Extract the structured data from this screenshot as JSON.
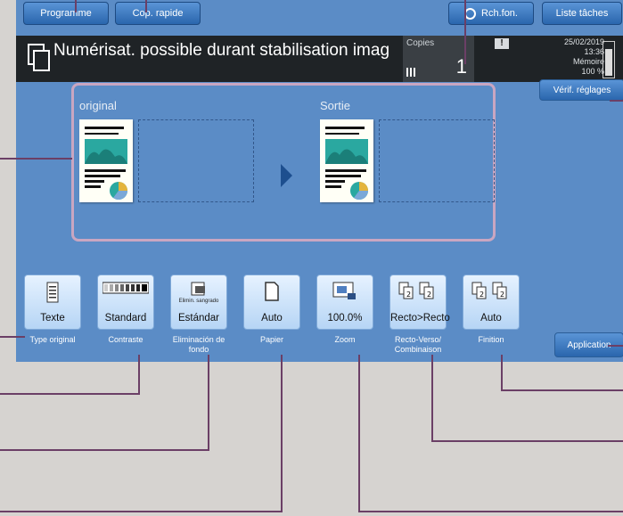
{
  "top_buttons": {
    "program": "Programme",
    "quick_copy": "Cop. rapide",
    "search": "Rch.fon.",
    "job_list": "Liste tâches"
  },
  "status": {
    "message": "Numérisat. possible durant stabilisation imag",
    "copies_label": "Copies",
    "copies_value": "1",
    "warning_mark": "!",
    "date": "25/02/2019",
    "time": "13:36",
    "memory_label": "Mémoire",
    "memory_value": "100 %"
  },
  "settings_check": "Vérif. réglages",
  "preview": {
    "original_label": "original",
    "output_label": "Sortie"
  },
  "functions": [
    {
      "id": "original-type",
      "value": "Texte",
      "label": "Type original"
    },
    {
      "id": "contrast",
      "value": "Standard",
      "label": "Contraste"
    },
    {
      "id": "bg-removal",
      "value": "Estándar",
      "label": "Eliminación de fondo",
      "icon_caption": "Elimin. sangrado"
    },
    {
      "id": "paper",
      "value": "Auto",
      "label": "Papier"
    },
    {
      "id": "zoom",
      "value": "100.0%",
      "label": "Zoom"
    },
    {
      "id": "duplex",
      "value": "Recto>Recto",
      "label": "Recto-Verso/ Combinaison"
    },
    {
      "id": "finishing",
      "value": "Auto",
      "label": "Finition"
    }
  ],
  "application": "Application",
  "colors": {
    "panel": "#5b8cc6",
    "status_bar": "#1f2326",
    "callout_line": "#6b3f66",
    "preview_frame": "#c9a6c1"
  }
}
